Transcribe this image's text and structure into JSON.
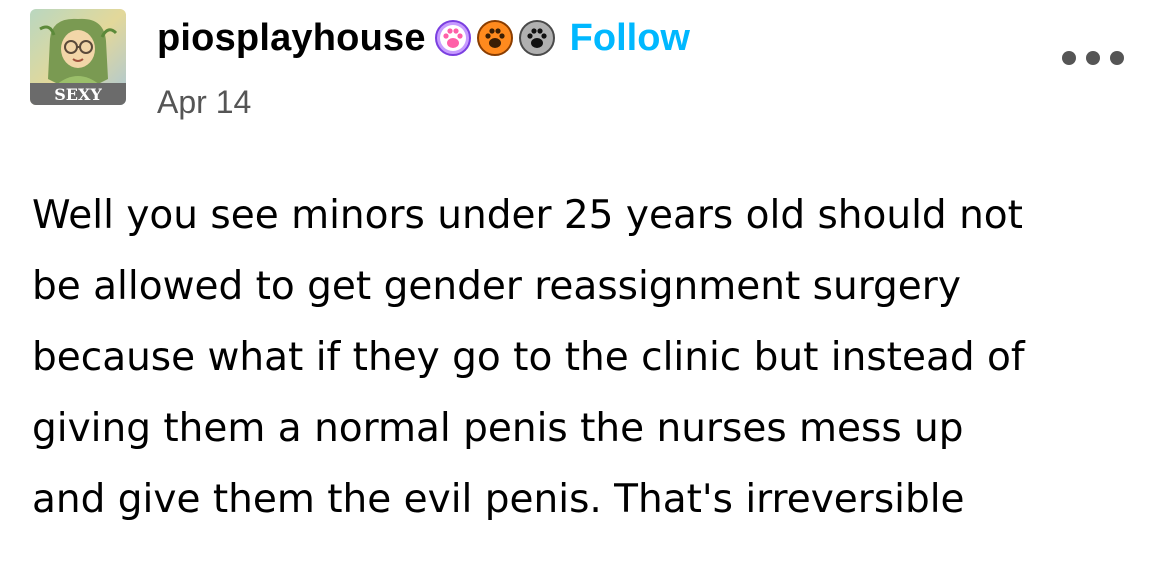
{
  "header": {
    "username": "piosplayhouse",
    "avatar_label": "SEXY",
    "follow_label": "Follow",
    "date": "Apr 14",
    "badges": [
      {
        "name": "pink-paw-badge",
        "color": "#b77bff"
      },
      {
        "name": "orange-paw-badge",
        "color": "#ff8a1e"
      },
      {
        "name": "gray-paw-badge",
        "color": "#9a9a9a"
      }
    ],
    "more_menu_icon": "more-dots-icon"
  },
  "colors": {
    "follow": "#00b8ff",
    "date": "#555555",
    "text": "#000000"
  },
  "post": {
    "lines": [
      "Well you see minors under 25 years old should not",
      "be allowed to get gender reassignment surgery",
      "because what if they go to the clinic but instead of",
      "giving them a normal penis the nurses mess up",
      "and give them the evil penis. That's irreversible"
    ]
  }
}
